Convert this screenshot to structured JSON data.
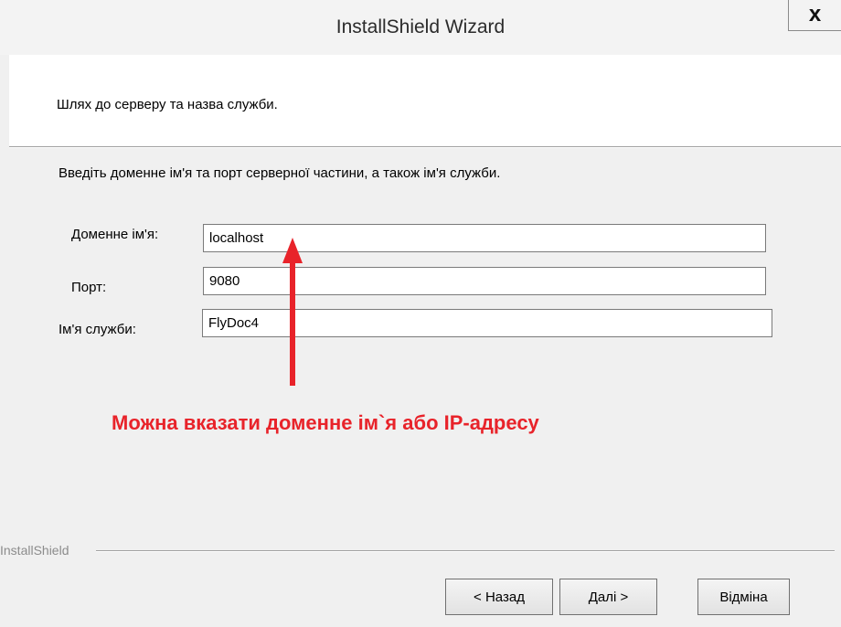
{
  "window": {
    "title": "InstallShield Wizard",
    "close_glyph": "x"
  },
  "header": {
    "text": "Шлях до серверу та назва служби."
  },
  "main": {
    "instruction": "Введіть доменне ім'я та порт серверної частини, а також ім'я служби.",
    "fields": {
      "domain": {
        "label": "Доменне ім'я:",
        "value": "localhost"
      },
      "port": {
        "label": "Порт:",
        "value": "9080"
      },
      "service": {
        "label": "Ім'я служби:",
        "value": "FlyDoc4"
      }
    },
    "annotation": "Можна вказати доменне ім`я або IP-адресу"
  },
  "footer": {
    "brand": "InstallShield",
    "back_label": "< Назад",
    "next_label": "Далі >",
    "cancel_label": "Відміна"
  },
  "colors": {
    "annotation": "#e8232a",
    "background": "#f0f0f0",
    "panel": "#ffffff"
  }
}
